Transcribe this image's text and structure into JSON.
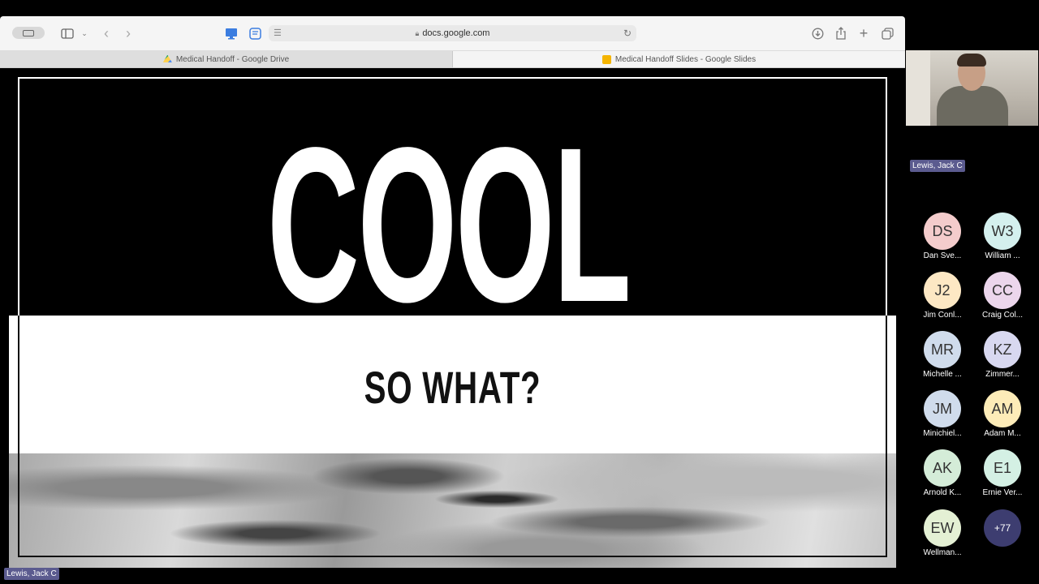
{
  "browser": {
    "url": "docs.google.com",
    "tabs": [
      {
        "label": "Medical Handoff - Google Drive",
        "favicon": "google-drive-icon",
        "active": false
      },
      {
        "label": "Medical Handoff Slides - Google Slides",
        "favicon": "google-slides-icon",
        "active": true
      }
    ]
  },
  "slide": {
    "headline": "COOL",
    "subheadline": "SO WHAT?"
  },
  "presenter": {
    "name": "Lewis, Jack C"
  },
  "active_speaker": {
    "name": "Lewis, Jack C"
  },
  "participants": [
    {
      "initials": "DS",
      "name": "Dan Sve...",
      "color": "#f4cccc"
    },
    {
      "initials": "W3",
      "name": "William ...",
      "color": "#d4f0ee"
    },
    {
      "initials": "J2",
      "name": "Jim Conl...",
      "color": "#fde8c4"
    },
    {
      "initials": "CC",
      "name": "Craig Col...",
      "color": "#ecd6ec"
    },
    {
      "initials": "MR",
      "name": "Michelle ...",
      "color": "#d0dcec"
    },
    {
      "initials": "KZ",
      "name": "Zimmer...",
      "color": "#d8d8f0"
    },
    {
      "initials": "JM",
      "name": "Minichiel...",
      "color": "#d0dcec"
    },
    {
      "initials": "AM",
      "name": "Adam M...",
      "color": "#fdecb8"
    },
    {
      "initials": "AK",
      "name": "Arnold K...",
      "color": "#d4ecd8"
    },
    {
      "initials": "E1",
      "name": "Ernie Ver...",
      "color": "#d4f0e4"
    },
    {
      "initials": "EW",
      "name": "Wellman...",
      "color": "#e4f0d4"
    }
  ],
  "more_participants": "+77"
}
